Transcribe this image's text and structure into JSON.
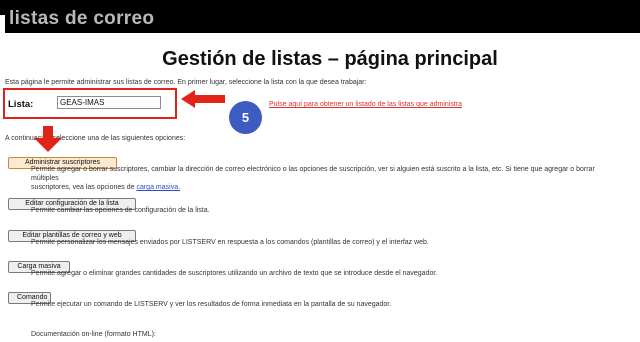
{
  "header": {
    "title": "listas de correo"
  },
  "page": {
    "title": "Gestión de listas – página principal",
    "intro": "Esta página le permite administrar sus listas de correo. En primer lugar, seleccione la lista con la que desea trabajar:"
  },
  "lista": {
    "label": "Lista:",
    "value": "GEAS-IMAS"
  },
  "badge": {
    "value": "5"
  },
  "links": {
    "red": "Pulse aquí para obtener un listado de las listas que administra"
  },
  "continue_text": "A continuación seleccione una de las siguientes opciones:",
  "options": [
    {
      "label": "Administrar suscriptores",
      "desc": "Permite agregar o borrar suscriptores, cambiar la dirección de correo electrónico o las opciones de suscripción, ver si alguien está suscrito a la lista, etc. Si tiene que agregar o borrar múltiples",
      "desc2": "suscriptores, vea las opciones de",
      "desc_link": "carga masiva."
    },
    {
      "label": "Editar configuración de la lista",
      "desc": "Permite cambiar las opciones de configuración de la lista."
    },
    {
      "label": "Editar plantillas de correo y web",
      "desc": "Permite personalizar los mensajes enviados por LISTSERV en respuesta a los comandos (plantillas de correo) y el interfaz web."
    },
    {
      "label": "Carga masiva",
      "desc": "Permite agregar o eliminar grandes cantidades de suscriptores utilizando un archivo de texto que se introduce desde el navegador."
    },
    {
      "label": "Comando",
      "desc": "Permite ejecutar un comando de LISTSERV y ver los resultados de forma inmediata en la pantalla de su navegador."
    }
  ],
  "footer": {
    "doc": "Documentación on-line (formato HTML):"
  },
  "colors": {
    "highlight": "#e2231a",
    "badge": "#3d5bc0",
    "header": "#000000"
  }
}
